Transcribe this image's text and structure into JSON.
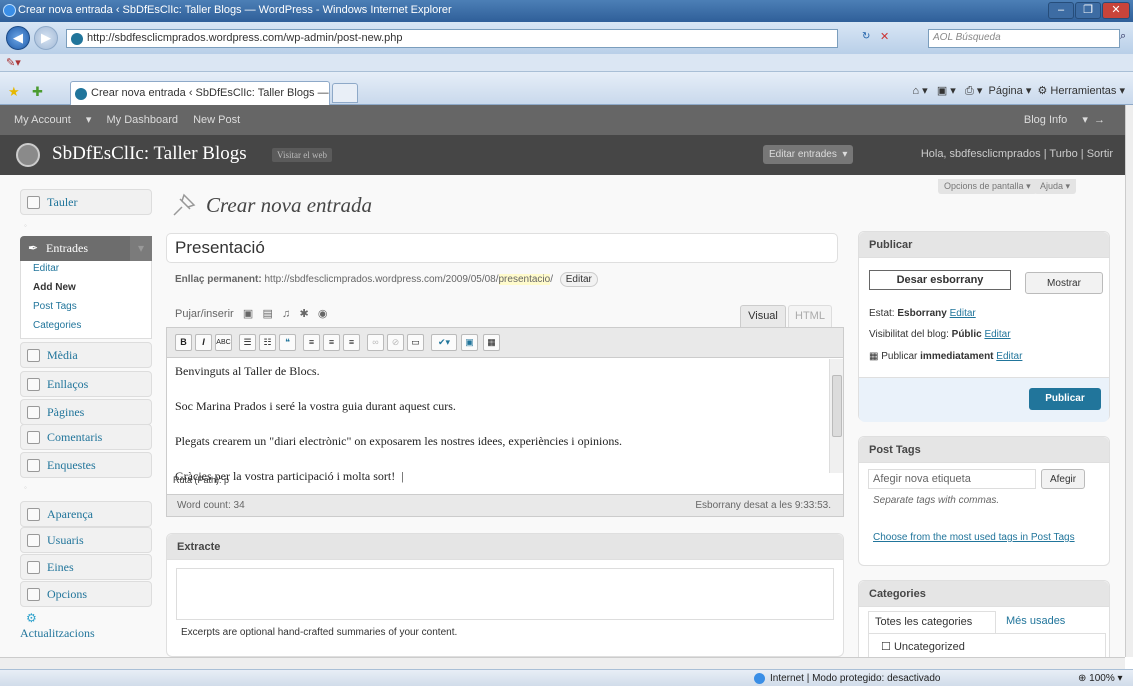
{
  "browser": {
    "window_title": "Crear nova entrada ‹ SbDfEsClIc: Taller Blogs — WordPress - Windows Internet Explorer",
    "url": "http://sbdfesclicmprados.wordpress.com/wp-admin/post-new.php",
    "search_placeholder": "AOL Búsqueda",
    "tab_title": "Crear nova entrada ‹ SbDfEsClIc: Taller Blogs — ...",
    "tools": [
      "Página",
      "Herramientas"
    ],
    "status_text": "Internet | Modo protegido: desactivado",
    "zoom": "100%"
  },
  "adminbar": {
    "items": [
      "My Account",
      "My Dashboard",
      "New Post"
    ],
    "blog_info": "Blog Info"
  },
  "header": {
    "blog_title": "SbDfEsClIc: Taller Blogs",
    "visit_site": "Visitar el web",
    "edit_entries": "Editar entrades",
    "greeting": "Hola, sbdfesclicmprados | Turbo | Sortir"
  },
  "screen_options": "Opcions de pantalla",
  "help": "Ajuda",
  "menu": {
    "dashboard": "Tauler",
    "entries": "Entrades",
    "sub": [
      "Editar",
      "Add New",
      "Post Tags",
      "Categories"
    ],
    "items": [
      "Mèdia",
      "Enllaços",
      "Pàgines",
      "Comentaris",
      "Enquestes"
    ],
    "items2": [
      "Aparença",
      "Usuaris",
      "Eines",
      "Opcions",
      "Actualitzacions"
    ]
  },
  "page_title": "Crear nova entrada",
  "post": {
    "title": "Presentació",
    "permalink_label": "Enllaç permanent:",
    "permalink_base": "http://sbdfesclicmprados.wordpress.com/2009/05/08/",
    "permalink_slug": "presentacio",
    "permalink_edit": "Editar",
    "upload_label": "Pujar/inserir",
    "tab_visual": "Visual",
    "tab_html": "HTML",
    "content": [
      "Benvinguts al Taller de Blocs.",
      "Soc Marina Prados i seré la vostra guia durant aquest curs.",
      "Plegats crearem un \"diari electrònic\" on exposarem les nostres idees, experiències i opinions.",
      "Gràcies per la vostra participació i molta sort!"
    ],
    "path": "Ruta (Path): p",
    "word_count": "Word count: 34",
    "draft_saved": "Esborrany desat a les 9:33:53."
  },
  "excerpt": {
    "title": "Extracte",
    "note": "Excerpts are optional hand-crafted summaries of your content."
  },
  "publish": {
    "title": "Publicar",
    "save_draft": "Desar esborrany",
    "preview": "Mostrar",
    "status_label": "Estat:",
    "status_value": "Esborrany",
    "visibility_label": "Visibilitat del blog:",
    "visibility_value": "Públic",
    "publish_label": "Publicar",
    "publish_value": "immediatament",
    "edit": "Editar",
    "publish_button": "Publicar"
  },
  "tags": {
    "title": "Post Tags",
    "placeholder": "Afegir nova etiqueta",
    "add": "Afegir",
    "note": "Separate tags with commas.",
    "most_used": "Choose from the most used tags in Post Tags"
  },
  "categories": {
    "title": "Categories",
    "tab_all": "Totes les categories",
    "tab_most": "Més usades",
    "item": "Uncategorized"
  }
}
